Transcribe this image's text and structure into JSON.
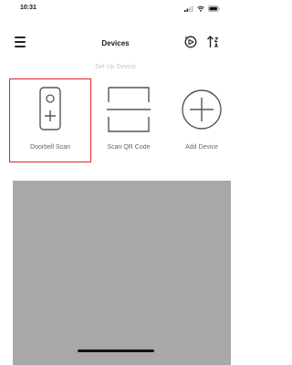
{
  "status_bar": {
    "time": "10:31",
    "icons": [
      "signal-icon",
      "wifi-icon",
      "battery-icon"
    ]
  },
  "header": {
    "title": "Devices",
    "menu_icon": "menu-icon",
    "right_icons": [
      "scan-icon",
      "sort-icon"
    ]
  },
  "setup": {
    "subtitle": "Set Up Device",
    "options": [
      {
        "label": "Doorbell Scan",
        "icon": "doorbell-icon",
        "highlighted": true
      },
      {
        "label": "Scan QR Code",
        "icon": "qr-scan-icon",
        "highlighted": false
      },
      {
        "label": "Add Device",
        "icon": "plus-circle-icon",
        "highlighted": false
      }
    ]
  },
  "colors": {
    "highlight": "#e2262a",
    "icon_stroke": "#555555",
    "panel": "#a8a8a8"
  }
}
